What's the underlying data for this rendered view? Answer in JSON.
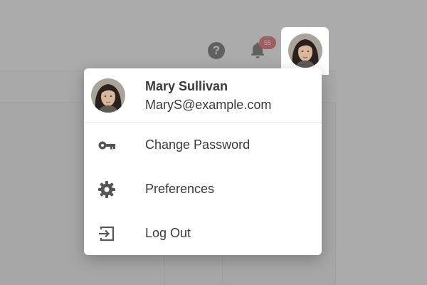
{
  "header": {
    "help_icon": "question-circle-icon",
    "help_glyph": "?",
    "notifications_icon": "bell-icon",
    "notifications_count": "55"
  },
  "user": {
    "name": "Mary Sullivan",
    "email": "MaryS@example.com",
    "avatar_icon": "avatar-photo"
  },
  "menu": {
    "items": [
      {
        "label": "Change Password",
        "icon": "key-icon"
      },
      {
        "label": "Preferences",
        "icon": "gear-icon"
      },
      {
        "label": "Log Out",
        "icon": "logout-icon"
      }
    ]
  },
  "colors": {
    "overlay": "#787878",
    "badge": "#e0393e",
    "text": "#3a3a3a",
    "icon": "#555555"
  }
}
